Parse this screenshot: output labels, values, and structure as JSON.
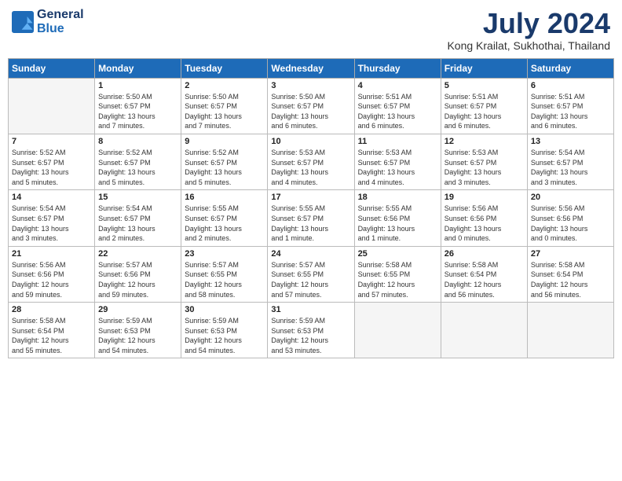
{
  "header": {
    "logo_line1": "General",
    "logo_line2": "Blue",
    "month_year": "July 2024",
    "location": "Kong Krailat, Sukhothai, Thailand"
  },
  "days_of_week": [
    "Sunday",
    "Monday",
    "Tuesday",
    "Wednesday",
    "Thursday",
    "Friday",
    "Saturday"
  ],
  "weeks": [
    [
      {
        "day": "",
        "info": ""
      },
      {
        "day": "1",
        "info": "Sunrise: 5:50 AM\nSunset: 6:57 PM\nDaylight: 13 hours\nand 7 minutes."
      },
      {
        "day": "2",
        "info": "Sunrise: 5:50 AM\nSunset: 6:57 PM\nDaylight: 13 hours\nand 7 minutes."
      },
      {
        "day": "3",
        "info": "Sunrise: 5:50 AM\nSunset: 6:57 PM\nDaylight: 13 hours\nand 6 minutes."
      },
      {
        "day": "4",
        "info": "Sunrise: 5:51 AM\nSunset: 6:57 PM\nDaylight: 13 hours\nand 6 minutes."
      },
      {
        "day": "5",
        "info": "Sunrise: 5:51 AM\nSunset: 6:57 PM\nDaylight: 13 hours\nand 6 minutes."
      },
      {
        "day": "6",
        "info": "Sunrise: 5:51 AM\nSunset: 6:57 PM\nDaylight: 13 hours\nand 6 minutes."
      }
    ],
    [
      {
        "day": "7",
        "info": "Sunrise: 5:52 AM\nSunset: 6:57 PM\nDaylight: 13 hours\nand 5 minutes."
      },
      {
        "day": "8",
        "info": "Sunrise: 5:52 AM\nSunset: 6:57 PM\nDaylight: 13 hours\nand 5 minutes."
      },
      {
        "day": "9",
        "info": "Sunrise: 5:52 AM\nSunset: 6:57 PM\nDaylight: 13 hours\nand 5 minutes."
      },
      {
        "day": "10",
        "info": "Sunrise: 5:53 AM\nSunset: 6:57 PM\nDaylight: 13 hours\nand 4 minutes."
      },
      {
        "day": "11",
        "info": "Sunrise: 5:53 AM\nSunset: 6:57 PM\nDaylight: 13 hours\nand 4 minutes."
      },
      {
        "day": "12",
        "info": "Sunrise: 5:53 AM\nSunset: 6:57 PM\nDaylight: 13 hours\nand 3 minutes."
      },
      {
        "day": "13",
        "info": "Sunrise: 5:54 AM\nSunset: 6:57 PM\nDaylight: 13 hours\nand 3 minutes."
      }
    ],
    [
      {
        "day": "14",
        "info": "Sunrise: 5:54 AM\nSunset: 6:57 PM\nDaylight: 13 hours\nand 3 minutes."
      },
      {
        "day": "15",
        "info": "Sunrise: 5:54 AM\nSunset: 6:57 PM\nDaylight: 13 hours\nand 2 minutes."
      },
      {
        "day": "16",
        "info": "Sunrise: 5:55 AM\nSunset: 6:57 PM\nDaylight: 13 hours\nand 2 minutes."
      },
      {
        "day": "17",
        "info": "Sunrise: 5:55 AM\nSunset: 6:57 PM\nDaylight: 13 hours\nand 1 minute."
      },
      {
        "day": "18",
        "info": "Sunrise: 5:55 AM\nSunset: 6:56 PM\nDaylight: 13 hours\nand 1 minute."
      },
      {
        "day": "19",
        "info": "Sunrise: 5:56 AM\nSunset: 6:56 PM\nDaylight: 13 hours\nand 0 minutes."
      },
      {
        "day": "20",
        "info": "Sunrise: 5:56 AM\nSunset: 6:56 PM\nDaylight: 13 hours\nand 0 minutes."
      }
    ],
    [
      {
        "day": "21",
        "info": "Sunrise: 5:56 AM\nSunset: 6:56 PM\nDaylight: 12 hours\nand 59 minutes."
      },
      {
        "day": "22",
        "info": "Sunrise: 5:57 AM\nSunset: 6:56 PM\nDaylight: 12 hours\nand 59 minutes."
      },
      {
        "day": "23",
        "info": "Sunrise: 5:57 AM\nSunset: 6:55 PM\nDaylight: 12 hours\nand 58 minutes."
      },
      {
        "day": "24",
        "info": "Sunrise: 5:57 AM\nSunset: 6:55 PM\nDaylight: 12 hours\nand 57 minutes."
      },
      {
        "day": "25",
        "info": "Sunrise: 5:58 AM\nSunset: 6:55 PM\nDaylight: 12 hours\nand 57 minutes."
      },
      {
        "day": "26",
        "info": "Sunrise: 5:58 AM\nSunset: 6:54 PM\nDaylight: 12 hours\nand 56 minutes."
      },
      {
        "day": "27",
        "info": "Sunrise: 5:58 AM\nSunset: 6:54 PM\nDaylight: 12 hours\nand 56 minutes."
      }
    ],
    [
      {
        "day": "28",
        "info": "Sunrise: 5:58 AM\nSunset: 6:54 PM\nDaylight: 12 hours\nand 55 minutes."
      },
      {
        "day": "29",
        "info": "Sunrise: 5:59 AM\nSunset: 6:53 PM\nDaylight: 12 hours\nand 54 minutes."
      },
      {
        "day": "30",
        "info": "Sunrise: 5:59 AM\nSunset: 6:53 PM\nDaylight: 12 hours\nand 54 minutes."
      },
      {
        "day": "31",
        "info": "Sunrise: 5:59 AM\nSunset: 6:53 PM\nDaylight: 12 hours\nand 53 minutes."
      },
      {
        "day": "",
        "info": ""
      },
      {
        "day": "",
        "info": ""
      },
      {
        "day": "",
        "info": ""
      }
    ]
  ]
}
